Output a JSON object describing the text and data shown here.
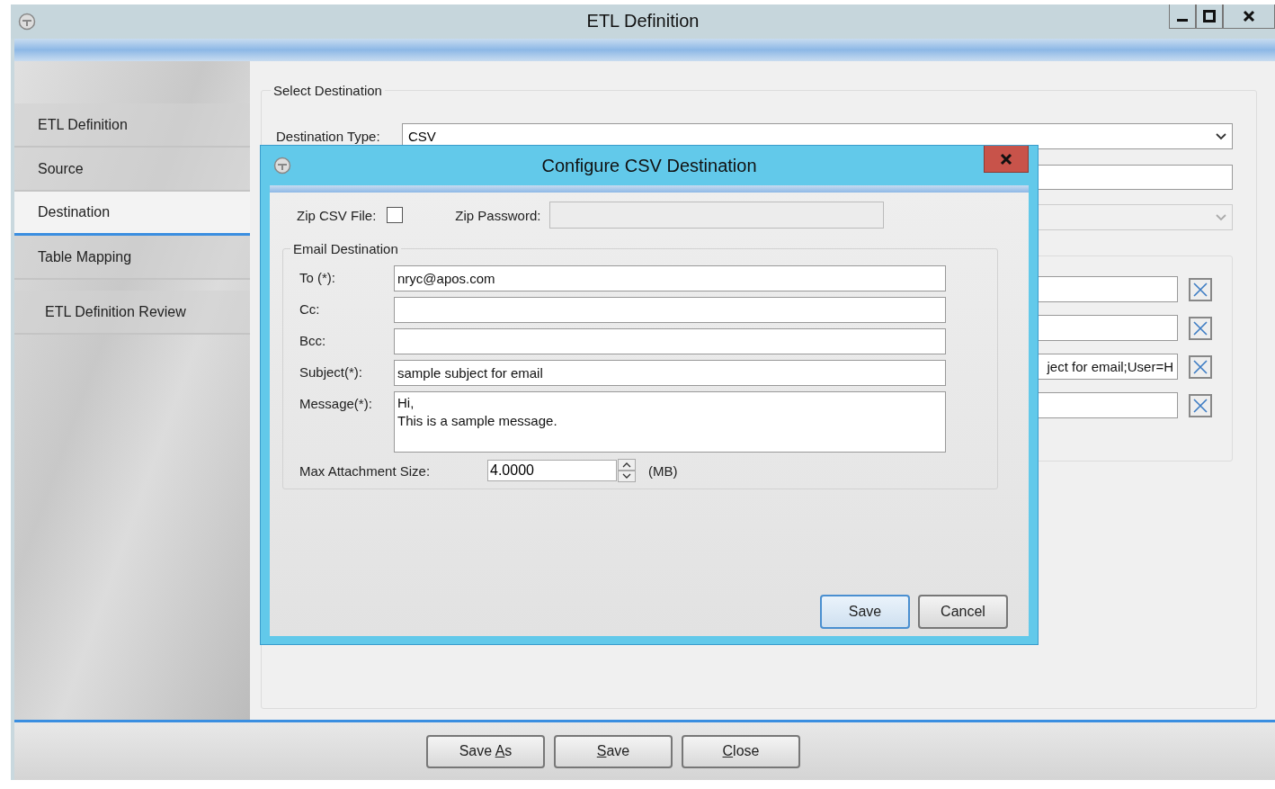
{
  "window": {
    "title": "ETL Definition"
  },
  "sidebar": {
    "items": [
      {
        "label": "ETL Definition",
        "selected": false
      },
      {
        "label": "Source",
        "selected": false
      },
      {
        "label": "Destination",
        "selected": true
      },
      {
        "label": "Table Mapping",
        "selected": false
      },
      {
        "label": "ETL Definition Review",
        "selected": false
      }
    ]
  },
  "select_destination": {
    "title": "Select Destination",
    "destination_type": {
      "label": "Destination Type:",
      "value": "CSV"
    },
    "second_dropdown": {
      "disabled": true
    },
    "rows": [
      {
        "removable": true
      },
      {
        "removable": true
      },
      {
        "value": "ject for email;User=H",
        "removable": true
      },
      {
        "removable": true
      }
    ]
  },
  "footer_buttons": [
    {
      "before": "Save ",
      "key": "A",
      "after": "s"
    },
    {
      "key": "S",
      "after": "ave"
    },
    {
      "key": "C",
      "after": "lose"
    }
  ],
  "dialog": {
    "title": "Configure CSV Destination",
    "zip_csv_file": {
      "label": "Zip CSV File:",
      "checked": false
    },
    "zip_password": {
      "label": "Zip Password:",
      "disabled": true
    },
    "email_destination": {
      "title": "Email Destination",
      "fields": [
        {
          "label": "To (*):",
          "value": "nryc@apos.com",
          "kind": "text"
        },
        {
          "label": "Cc:",
          "kind": "text"
        },
        {
          "label": "Bcc:",
          "kind": "text"
        },
        {
          "label": "Subject(*):",
          "value": "sample subject for email",
          "kind": "text"
        },
        {
          "label": "Message(*):",
          "value": "Hi,\nThis is a sample message.",
          "kind": "multiline"
        }
      ],
      "max_attachment": {
        "label": "Max Attachment Size:",
        "value": "4.0000",
        "unit": "(MB)"
      }
    },
    "buttons": [
      {
        "label": "Save",
        "selected": true
      },
      {
        "label": "Cancel",
        "selected": false
      }
    ]
  }
}
